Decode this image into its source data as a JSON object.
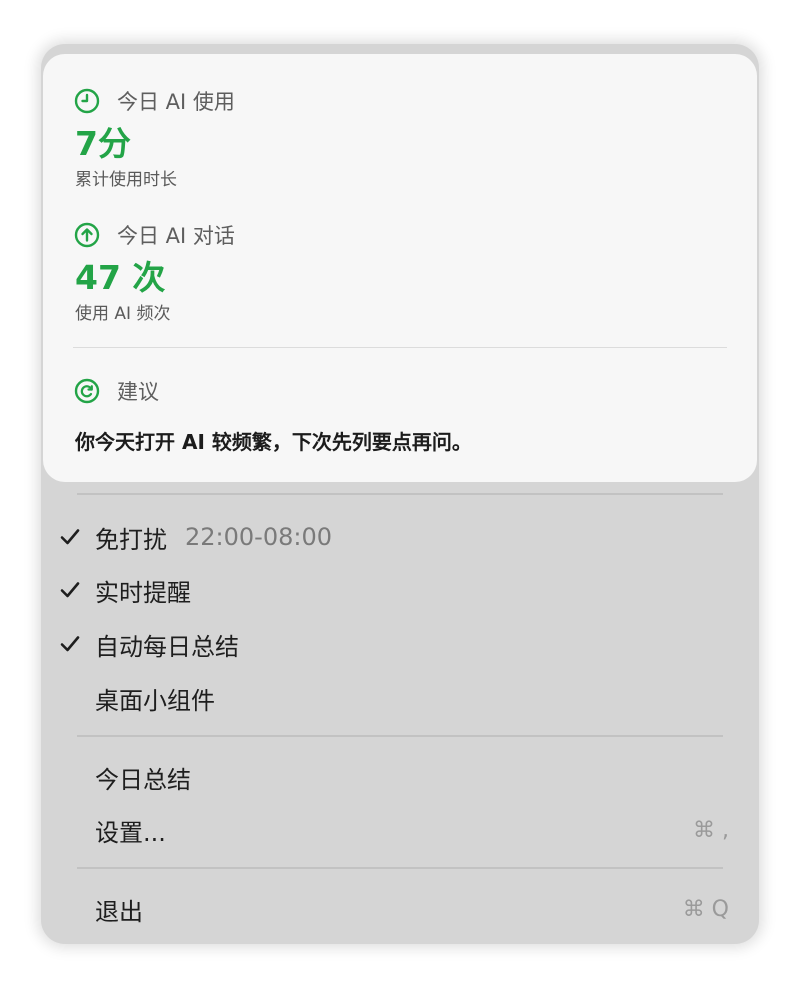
{
  "stats": {
    "usage": {
      "title": "今日 AI 使用",
      "value": "7分",
      "caption": "累计使用时长",
      "icon": "clock-icon"
    },
    "conversations": {
      "title": "今日 AI 对话",
      "value": "47 次",
      "caption": "使用 AI 频次",
      "icon": "arrow-up-circle-icon"
    },
    "suggestion": {
      "title": "建议",
      "text": "你今天打开 AI 较频繁，下次先列要点再问。",
      "icon": "refresh-icon"
    }
  },
  "menu": {
    "dnd": {
      "label": "免打扰",
      "time": "22:00-08:00",
      "checked": true
    },
    "realtime": {
      "label": "实时提醒",
      "checked": true
    },
    "daily": {
      "label": "自动每日总结",
      "checked": true
    },
    "widget": {
      "label": "桌面小组件",
      "checked": false
    },
    "summary": {
      "label": "今日总结"
    },
    "settings": {
      "label": "设置...",
      "shortcut": "⌘ ,"
    },
    "quit": {
      "label": "退出",
      "shortcut": "⌘ Q"
    }
  },
  "colors": {
    "accent": "#23a447",
    "menu_bg": "#d5d5d5",
    "card_bg": "#f7f7f7"
  }
}
